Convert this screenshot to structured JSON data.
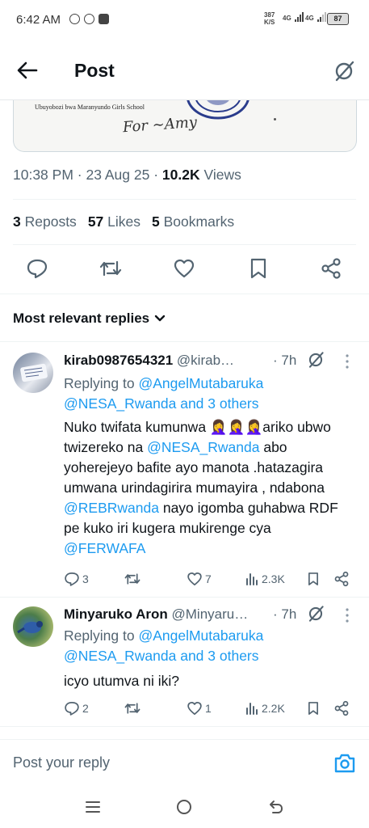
{
  "status_bar": {
    "time": "6:42 AM",
    "net_speed_value": "387",
    "net_speed_unit": "K/S",
    "signal_1": "4G",
    "signal_2": "4G",
    "battery": "87",
    "app_icons": [
      "whatsapp-icon",
      "whatsapp-icon",
      "youtube-icon"
    ]
  },
  "header": {
    "title": "Post"
  },
  "post": {
    "image_school_text": "Ubuyobozi bwa Maranyundo Girls School",
    "image_signature_text": "For ~Amy",
    "time": "10:38 PM",
    "date": "23 Aug 25",
    "views_count": "10.2K",
    "views_label": "Views",
    "reposts_count": "3",
    "reposts_label": "Reposts",
    "likes_count": "57",
    "likes_label": "Likes",
    "bookmarks_count": "5",
    "bookmarks_label": "Bookmarks"
  },
  "replies_filter": "Most relevant replies",
  "replies": [
    {
      "name": "kirab0987654321",
      "handle": "@kirab…",
      "time": "· 7h",
      "replying_prefix": "Replying to",
      "replying_to": "@AngelMutabaruka",
      "replying_others": "@NESA_Rwanda and 3 others",
      "text_parts": [
        "Nuko twifata kumunwa 🤦‍♀️🤦‍♀️🤦‍♀️ariko ubwo twizereko na ",
        "@NESA_Rwanda",
        " abo yoherejeyo bafite ayo manota .hatazagira umwana urindagirira mumayira , ndabona ",
        "@REBRwanda",
        " nayo igomba guhabwa RDF pe kuko iri kugera mukirenge cya ",
        "@FERWAFA"
      ],
      "replies_count": "3",
      "reposts_count": "",
      "likes_count": "7",
      "views_count": "2.3K"
    },
    {
      "name": "Minyaruko Aron",
      "handle": "@Minyaru…",
      "time": "· 7h",
      "replying_prefix": "Replying to",
      "replying_to": "@AngelMutabaruka",
      "replying_others": "@NESA_Rwanda and 3 others",
      "text": "icyo utumva ni iki?",
      "replies_count": "2",
      "reposts_count": "",
      "likes_count": "1",
      "views_count": "2.2K"
    }
  ],
  "compose": {
    "placeholder": "Post your reply"
  },
  "colors": {
    "accent": "#1d9bf0",
    "text_primary": "#0f1419",
    "text_secondary": "#536471",
    "divider": "#eff3f4"
  }
}
